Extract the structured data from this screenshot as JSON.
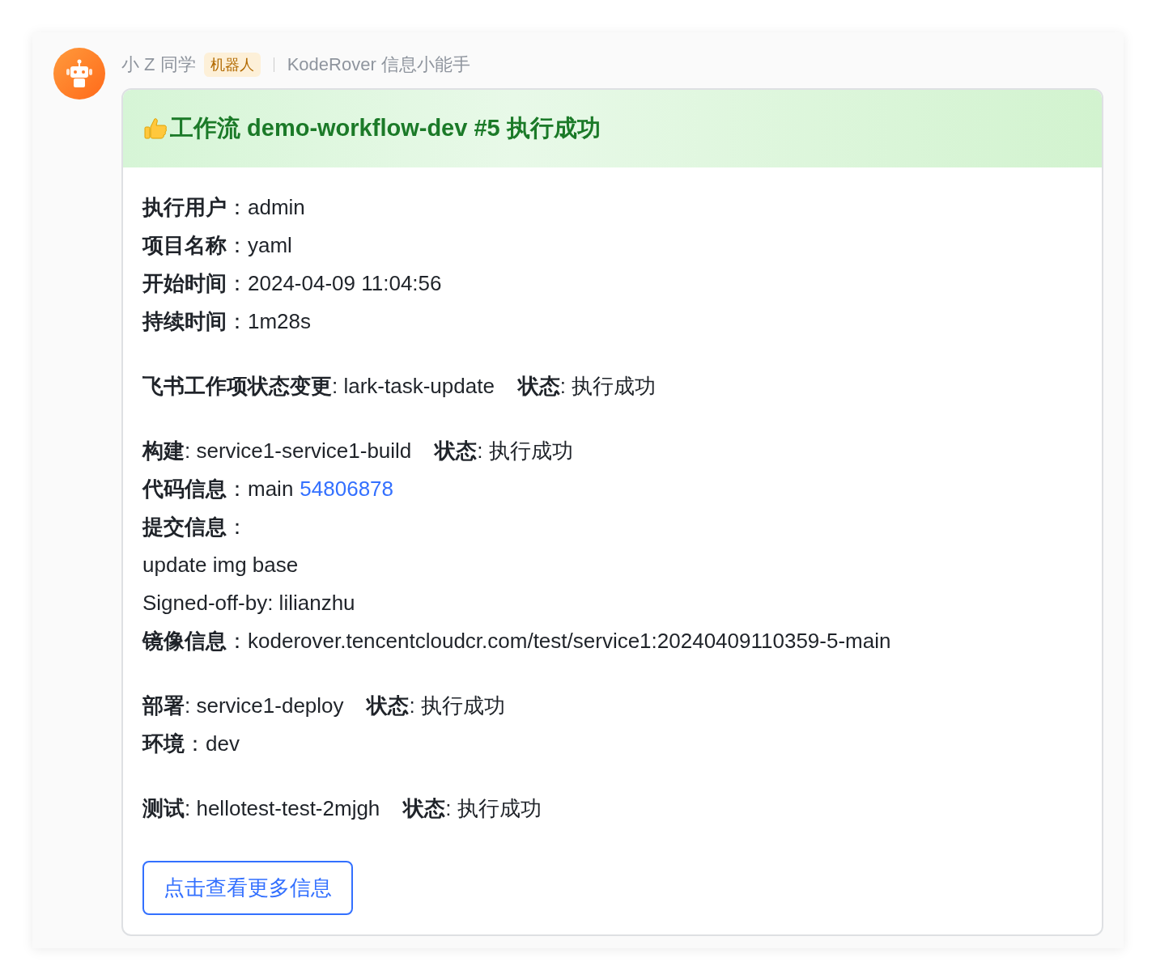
{
  "sender": {
    "name": "小 Z 同学",
    "badge": "机器人",
    "app": "KodeRover 信息小能手"
  },
  "card": {
    "title": "工作流 demo-workflow-dev #5 执行成功",
    "sections": [
      [
        {
          "text": "**执行用户**：admin"
        },
        {
          "text": "**项目名称**：yaml"
        },
        {
          "text": "**开始时间**：2024-04-09 11:04:56"
        },
        {
          "text": "**持续时间**：1m28s"
        }
      ],
      [
        {
          "text": "**飞书工作项状态变更**: lark-task-update    **状态**: 执行成功"
        }
      ],
      [
        {
          "text": "**构建**: service1-service1-build    **状态**: 执行成功"
        },
        {
          "text": "**代码信息**：main",
          "link": "54806878"
        },
        {
          "text": "**提交信息**："
        },
        {
          "text": "update img base"
        },
        {
          "text": "Signed-off-by: lilianzhu"
        },
        {
          "text": "**镜像信息**：koderover.tencentcloudcr.com/test/service1:20240409110359-5-main"
        }
      ],
      [
        {
          "text": "**部署**: service1-deploy    **状态**: 执行成功"
        },
        {
          "text": "**环境**：dev"
        }
      ],
      [
        {
          "text": "**测试**: hellotest-test-2mjgh    **状态**: 执行成功"
        }
      ]
    ],
    "button": "点击查看更多信息"
  }
}
